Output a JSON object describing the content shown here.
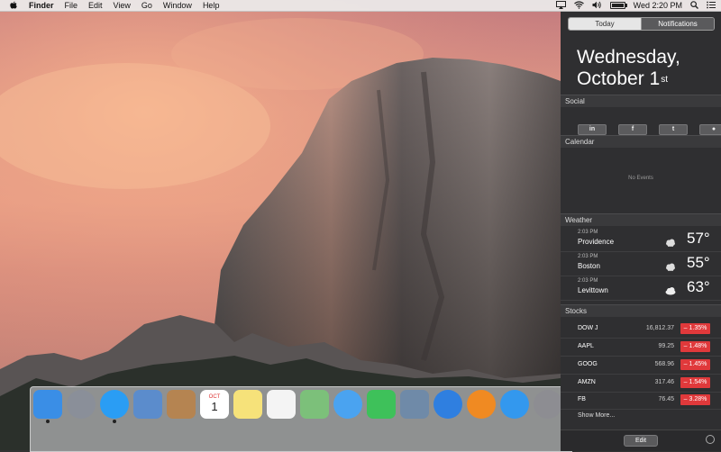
{
  "menubar": {
    "apple": "",
    "app_name": "Finder",
    "menus": [
      "File",
      "Edit",
      "View",
      "Go",
      "Window",
      "Help"
    ],
    "clock": "Wed 2:20 PM",
    "status_icons": [
      "airplay-icon",
      "wifi-icon",
      "volume-icon",
      "battery-icon",
      "spotlight-icon",
      "notification-list-icon"
    ]
  },
  "notification_center": {
    "tabs": [
      "Today",
      "Notifications"
    ],
    "active_tab": "Today",
    "date_line1": "Wednesday,",
    "date_line2": "October 1",
    "date_suffix": "st",
    "social": {
      "header": "Social",
      "buttons": [
        {
          "name": "linkedin",
          "glyph": "in"
        },
        {
          "name": "facebook",
          "glyph": "f"
        },
        {
          "name": "twitter",
          "glyph": "t"
        },
        {
          "name": "messages",
          "glyph": "●"
        }
      ]
    },
    "calendar": {
      "header": "Calendar",
      "empty_text": "No Events"
    },
    "weather": {
      "header": "Weather",
      "rows": [
        {
          "time": "2:03 PM",
          "city": "Providence",
          "temp": "57°",
          "icon": "cloud-sun-icon"
        },
        {
          "time": "2:03 PM",
          "city": "Boston",
          "temp": "55°",
          "icon": "cloud-sun-icon"
        },
        {
          "time": "2:03 PM",
          "city": "Levittown",
          "temp": "63°",
          "icon": "cloud-icon"
        }
      ]
    },
    "stocks": {
      "header": "Stocks",
      "rows": [
        {
          "symbol": "DOW J",
          "price": "16,812.37",
          "change": "– 1.35%"
        },
        {
          "symbol": "AAPL",
          "price": "99.25",
          "change": "– 1.48%"
        },
        {
          "symbol": "GOOG",
          "price": "568.96",
          "change": "– 1.45%"
        },
        {
          "symbol": "AMZN",
          "price": "317.46",
          "change": "– 1.54%"
        },
        {
          "symbol": "FB",
          "price": "76.45",
          "change": "– 3.28%"
        }
      ],
      "negative_color": "#e0393b"
    },
    "show_more": "Show More...",
    "edit_label": "Edit"
  },
  "dock": {
    "apps": [
      {
        "name": "finder",
        "label": "",
        "color": "#3a8ee6",
        "running": true
      },
      {
        "name": "launchpad",
        "label": "",
        "color": "#8a8f99",
        "running": false
      },
      {
        "name": "safari",
        "label": "",
        "color": "#2a9df4",
        "running": true
      },
      {
        "name": "mail",
        "label": "",
        "color": "#5b8ccc",
        "running": false
      },
      {
        "name": "contacts",
        "label": "",
        "color": "#b58451",
        "running": false
      },
      {
        "name": "calendar",
        "label": "1",
        "color": "#ffffff",
        "running": false
      },
      {
        "name": "notes",
        "label": "",
        "color": "#f6e27a",
        "running": false
      },
      {
        "name": "reminders",
        "label": "",
        "color": "#f4f4f4",
        "running": false
      },
      {
        "name": "maps",
        "label": "",
        "color": "#7cc07a",
        "running": false
      },
      {
        "name": "messages",
        "label": "",
        "color": "#4aa3f0",
        "running": false
      },
      {
        "name": "facetime",
        "label": "",
        "color": "#3ec15a",
        "running": false
      },
      {
        "name": "iphoto",
        "label": "",
        "color": "#6f8aa8",
        "running": false
      },
      {
        "name": "itunes",
        "label": "",
        "color": "#2f7fe0",
        "running": false
      },
      {
        "name": "ibooks",
        "label": "",
        "color": "#f08a22",
        "running": false
      },
      {
        "name": "app-store",
        "label": "",
        "color": "#3398ee",
        "running": false
      },
      {
        "name": "system-preferences",
        "label": "",
        "color": "#8d8d92",
        "running": false
      },
      {
        "name": "partial-app",
        "label": "",
        "color": "#f0a030",
        "running": false
      }
    ],
    "calendar_month": "OCT"
  }
}
